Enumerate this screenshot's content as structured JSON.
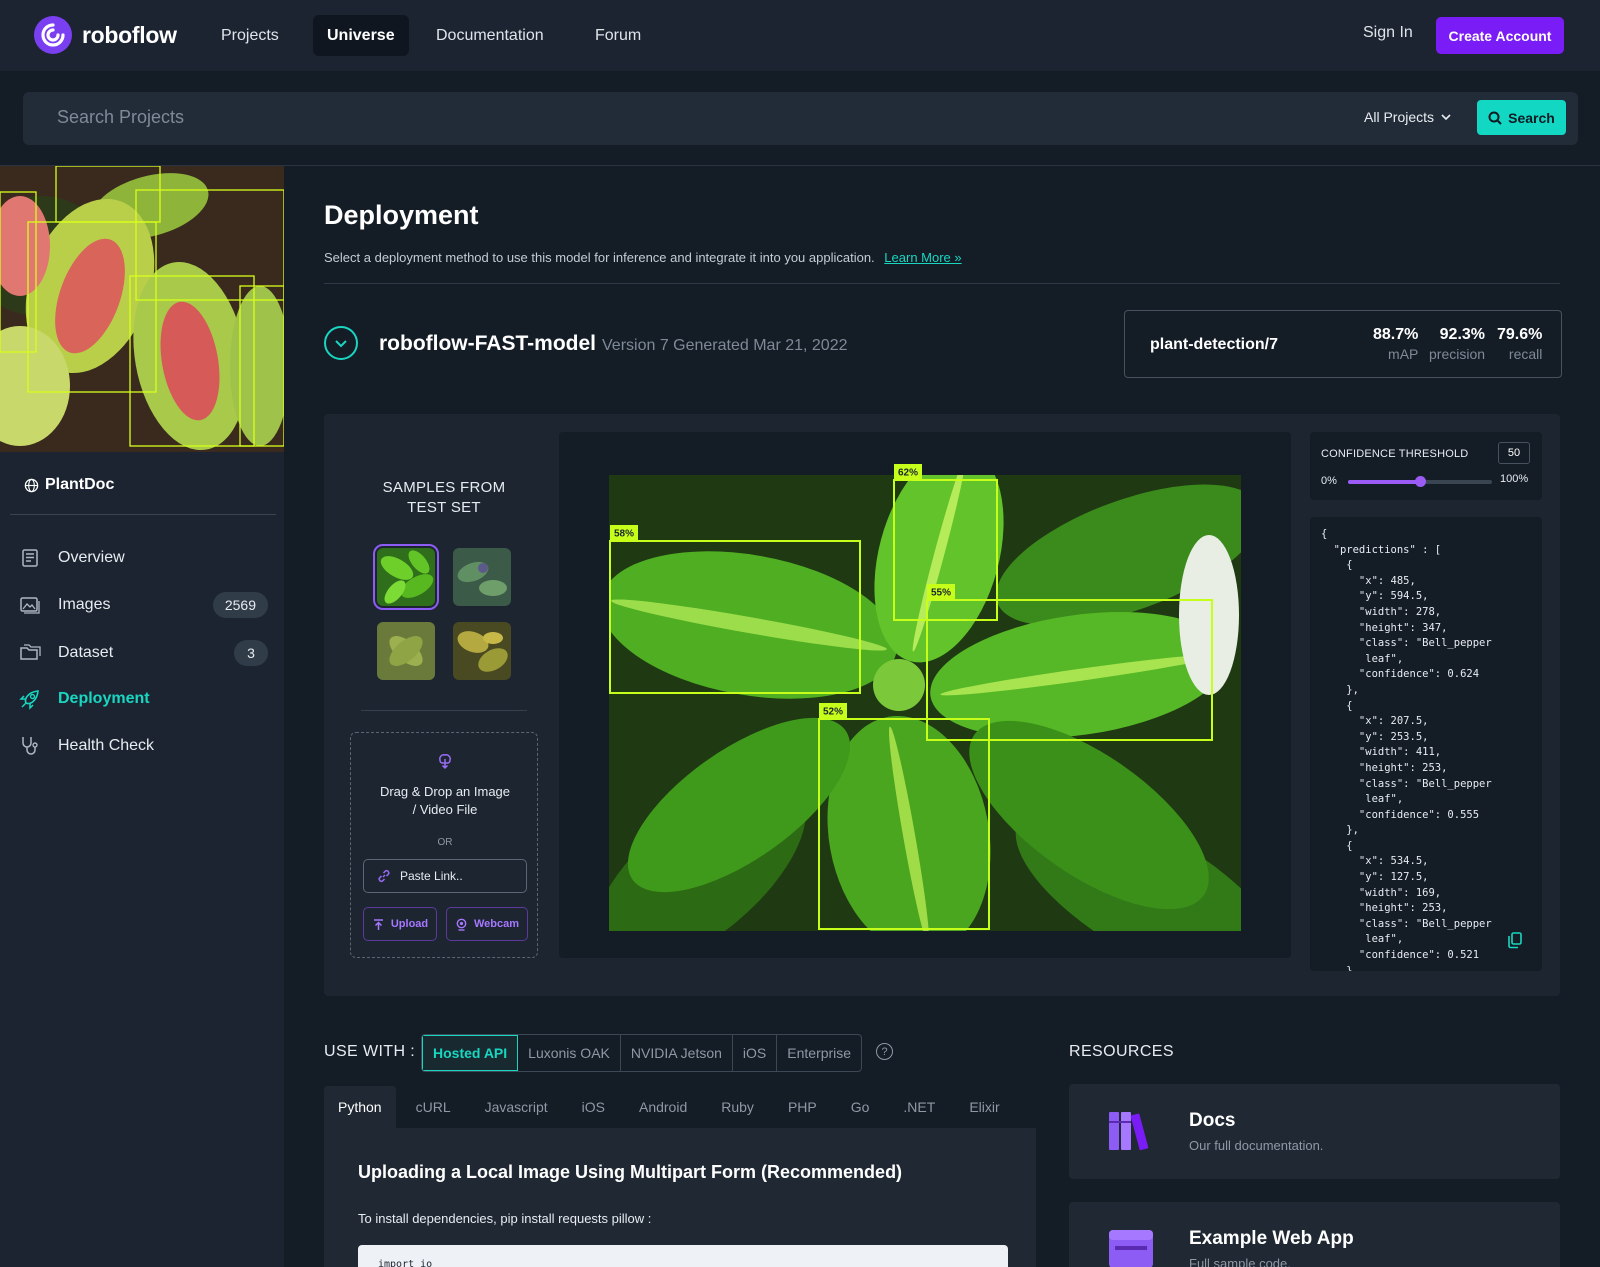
{
  "nav": {
    "brand": "roboflow",
    "items": [
      {
        "label": "Projects",
        "active": false
      },
      {
        "label": "Universe",
        "active": true
      },
      {
        "label": "Documentation",
        "active": false
      },
      {
        "label": "Forum",
        "active": false
      }
    ],
    "sign_in": "Sign In",
    "create_account": "Create Account"
  },
  "search": {
    "placeholder": "Search Projects",
    "scope": "All Projects",
    "button": "Search"
  },
  "sidebar": {
    "project": "PlantDoc",
    "items": [
      {
        "label": "Overview",
        "icon": "document-icon",
        "badge": null
      },
      {
        "label": "Images",
        "icon": "images-icon",
        "badge": "2569"
      },
      {
        "label": "Dataset",
        "icon": "folder-icon",
        "badge": "3"
      },
      {
        "label": "Deployment",
        "icon": "rocket-icon",
        "badge": null,
        "active": true
      },
      {
        "label": "Health Check",
        "icon": "stethoscope-icon",
        "badge": null
      }
    ]
  },
  "page": {
    "title": "Deployment",
    "description": "Select a deployment method to use this model for inference and integrate it into you application.",
    "learn_more": "Learn More »"
  },
  "model": {
    "name": "roboflow-FAST-model",
    "version": "Version 7 Generated Mar 21, 2022",
    "id": "plant-detection/7",
    "metrics": [
      {
        "value": "88.7%",
        "label": "mAP"
      },
      {
        "value": "92.3%",
        "label": "precision"
      },
      {
        "value": "79.6%",
        "label": "recall"
      }
    ]
  },
  "samples": {
    "title_line1": "SAMPLES FROM",
    "title_line2": "TEST SET",
    "drop_text_line1": "Drag & Drop an Image",
    "drop_text_line2": "/ Video File",
    "or": "OR",
    "paste_placeholder": "Paste Link..",
    "upload": "Upload",
    "webcam": "Webcam"
  },
  "detections": [
    {
      "label": "62%"
    },
    {
      "label": "58%"
    },
    {
      "label": "55%"
    },
    {
      "label": "52%"
    }
  ],
  "threshold": {
    "title": "CONFIDENCE THRESHOLD",
    "value": "50",
    "min": "0%",
    "max": "100%",
    "level": 0.5
  },
  "predictions_json": "{\n  \"predictions\" : [\n    {\n      \"x\": 485,\n      \"y\": 594.5,\n      \"width\": 278,\n      \"height\": 347,\n      \"class\": \"Bell_pepper\n       leaf\",\n      \"confidence\": 0.624\n    },\n    {\n      \"x\": 207.5,\n      \"y\": 253.5,\n      \"width\": 411,\n      \"height\": 253,\n      \"class\": \"Bell_pepper\n       leaf\",\n      \"confidence\": 0.555\n    },\n    {\n      \"x\": 534.5,\n      \"y\": 127.5,\n      \"width\": 169,\n      \"height\": 253,\n      \"class\": \"Bell_pepper\n       leaf\",\n      \"confidence\": 0.521\n    }",
  "use_with": {
    "label": "USE WITH :",
    "options": [
      "Hosted API",
      "Luxonis OAK",
      "NVIDIA Jetson",
      "iOS",
      "Enterprise"
    ],
    "help": "?"
  },
  "languages": [
    "Python",
    "cURL",
    "Javascript",
    "iOS",
    "Android",
    "Ruby",
    "PHP",
    "Go",
    ".NET",
    "Elixir"
  ],
  "code": {
    "title": "Uploading a Local Image Using Multipart Form (Recommended)",
    "install": "To install dependencies, pip install requests pillow :",
    "snippet": "import io"
  },
  "resources": {
    "title": "RESOURCES",
    "cards": [
      {
        "title": "Docs",
        "subtitle": "Our full documentation."
      },
      {
        "title": "Example Web App",
        "subtitle": "Full sample code."
      }
    ]
  },
  "colors": {
    "accent_teal": "#19d6c1",
    "accent_purple": "#7a1cf5",
    "detection_box": "#c6ff1a",
    "background": "#141c26"
  }
}
